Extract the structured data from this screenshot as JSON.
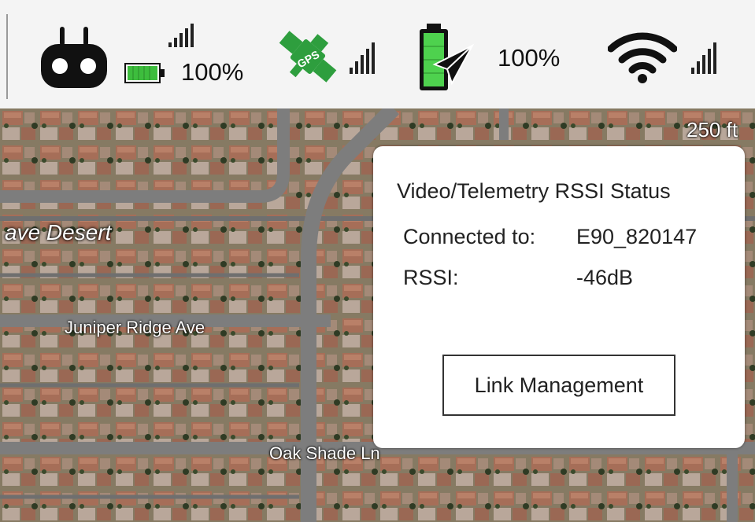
{
  "status_bar": {
    "remote_controller": {
      "icon": "remote-controller-icon",
      "battery_percent": "100%",
      "battery_level": 1.0,
      "signal_bars": 4
    },
    "gps": {
      "icon": "gps-satellite-icon",
      "label": "GPS",
      "signal_bars": 4
    },
    "aircraft": {
      "icon": "aircraft-battery-icon",
      "battery_percent": "100%",
      "battery_level": 1.0
    },
    "wifi": {
      "icon": "wifi-icon",
      "signal_bars": 4
    }
  },
  "map": {
    "scale_label": "250 ft",
    "area_label": "ave Desert",
    "streets": [
      "Juniper Ridge Ave",
      "Oak Shade Ln"
    ]
  },
  "rssi_dialog": {
    "title": "Video/Telemetry RSSI Status",
    "connected_label": "Connected to:",
    "connected_value": "E90_820147",
    "rssi_label": "RSSI:",
    "rssi_value": "-46dB",
    "link_button": "Link Management"
  },
  "colors": {
    "battery_green": "#3dbd3d",
    "gps_green": "#2e9e3e",
    "map_roof": "#9a6a55",
    "road": "#7d7d7d"
  }
}
